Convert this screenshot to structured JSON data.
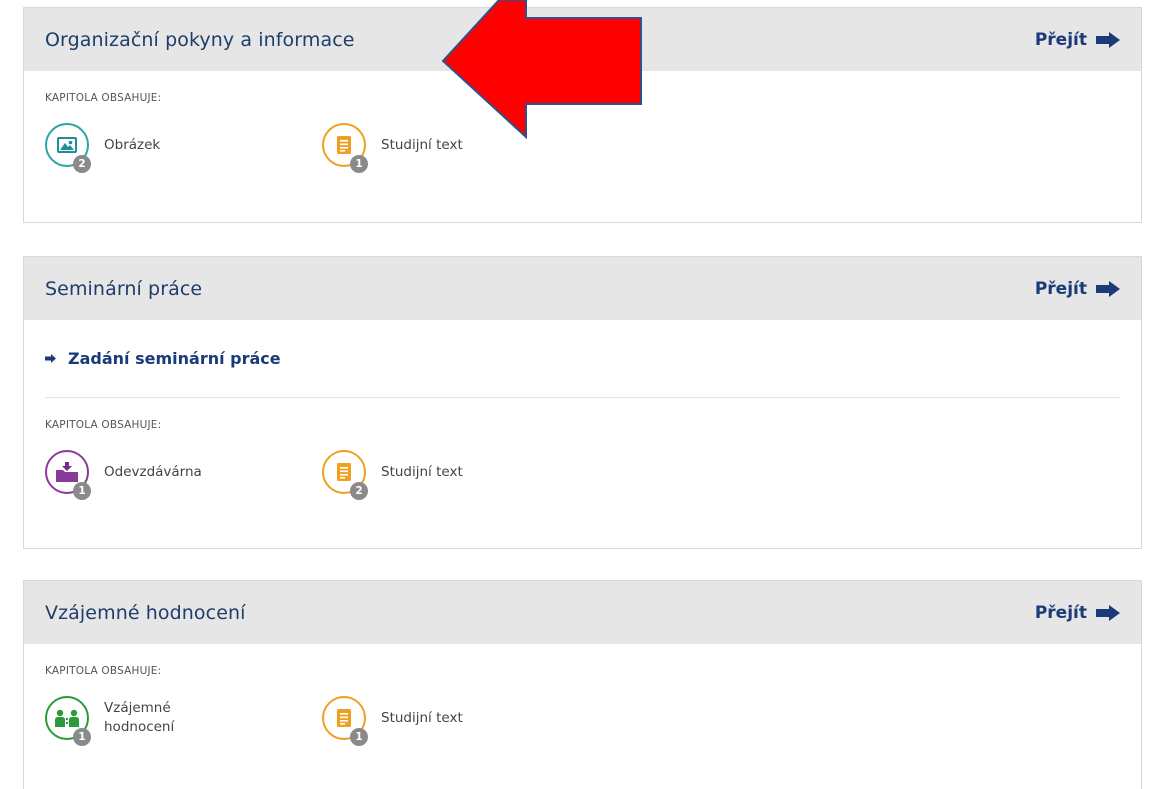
{
  "go_label": "Přejít",
  "contains_label": "KAPITOLA OBSAHUJE:",
  "colors": {
    "header_bg": "#e6e6e6",
    "title": "#1d3d6b",
    "link": "#1a3a78",
    "badge": "#8a8a8a",
    "annotation_arrow": "#ff0000"
  },
  "chapters": [
    {
      "title": "Organizační pokyny a informace",
      "items": [
        {
          "icon": "image-icon",
          "label": "Obrázek",
          "count": "2",
          "color": "#2aa5a5"
        },
        {
          "icon": "document-icon",
          "label": "Studijní text",
          "count": "1",
          "color": "#f0a020"
        }
      ]
    },
    {
      "title": "Seminární práce",
      "sublinks": [
        "Zadání seminární práce"
      ],
      "items": [
        {
          "icon": "folder-download-icon",
          "label": "Odevzdávárna",
          "count": "1",
          "color": "#8b3a9a"
        },
        {
          "icon": "document-icon",
          "label": "Studijní text",
          "count": "2",
          "color": "#f0a020"
        }
      ]
    },
    {
      "title": "Vzájemné hodnocení",
      "items": [
        {
          "icon": "peer-review-icon",
          "label": "Vzájemné hodnocení",
          "count": "1",
          "color": "#2a9a3a"
        },
        {
          "icon": "document-icon",
          "label": "Studijní text",
          "count": "1",
          "color": "#f0a020"
        }
      ]
    }
  ]
}
